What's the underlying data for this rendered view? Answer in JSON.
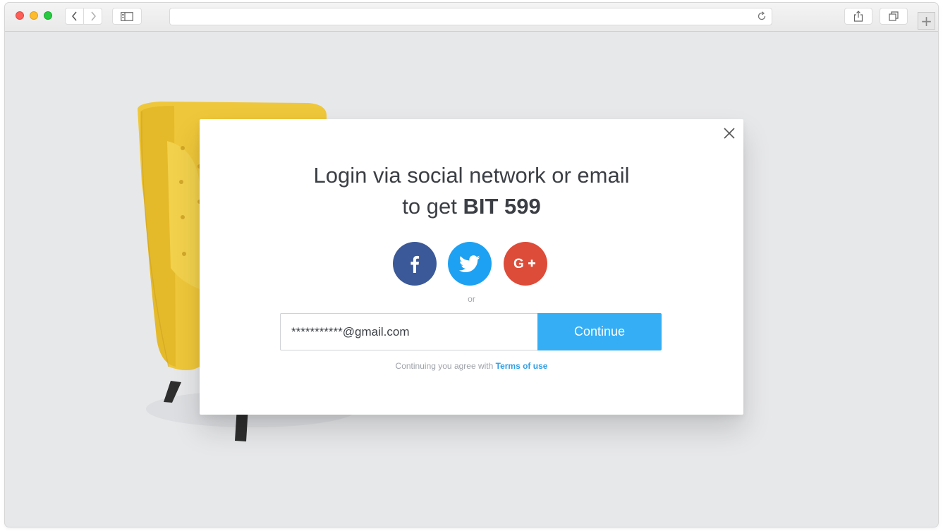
{
  "browser": {
    "window_controls": [
      "close",
      "minimize",
      "zoom"
    ],
    "url": "",
    "icons": [
      "back-icon",
      "forward-icon",
      "sidebar-icon",
      "reload-icon",
      "share-icon",
      "tabs-icon",
      "plus-icon"
    ]
  },
  "modal": {
    "title_line1": "Login via social network or email",
    "title_line2_prefix": "to get ",
    "title_line2_bold": "BIT 599",
    "social": [
      {
        "name": "facebook",
        "glyph": "f",
        "color": "#3b5998"
      },
      {
        "name": "twitter",
        "glyph": "bird",
        "color": "#1da1f2"
      },
      {
        "name": "google-plus",
        "glyph": "G+",
        "color": "#dd4b39"
      }
    ],
    "or_label": "or",
    "email_value": "***********@gmail.com",
    "continue_label": "Continue",
    "terms_prefix": "Continuing you agree with ",
    "terms_link": "Terms of use",
    "accent_color": "#35aef5"
  }
}
